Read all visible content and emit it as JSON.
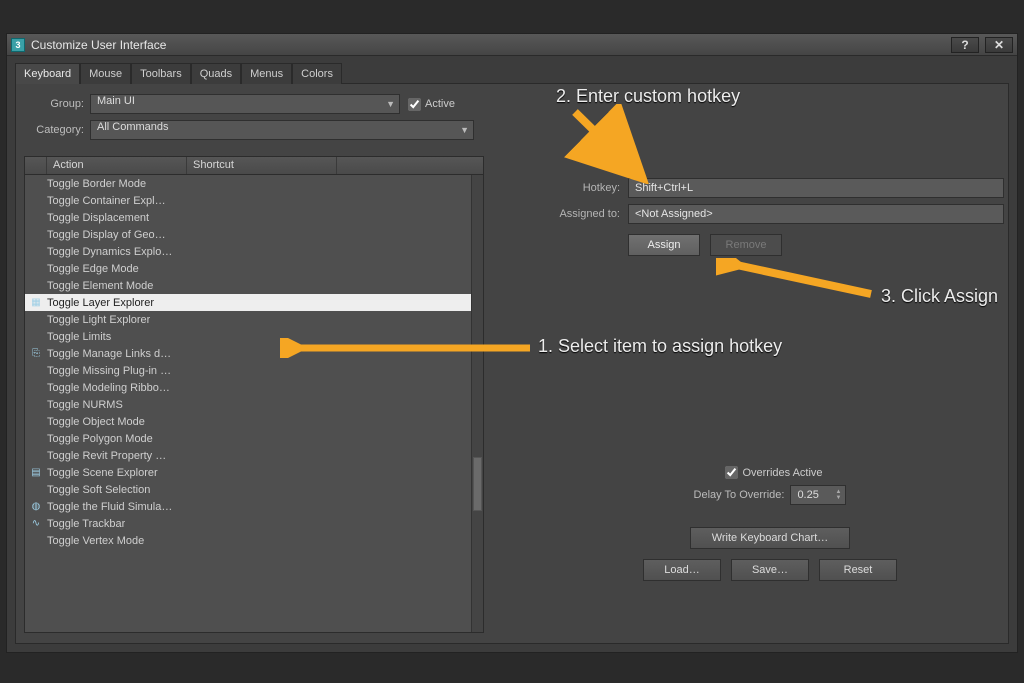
{
  "window": {
    "title": "Customize User Interface"
  },
  "tabs": [
    "Keyboard",
    "Mouse",
    "Toolbars",
    "Quads",
    "Menus",
    "Colors"
  ],
  "active_tab": 0,
  "group": {
    "label": "Group:",
    "value": "Main UI",
    "active_label": "Active"
  },
  "category": {
    "label": "Category:",
    "value": "All Commands"
  },
  "list": {
    "headers": {
      "action": "Action",
      "shortcut": "Shortcut"
    },
    "items": [
      {
        "icon": "",
        "label": "Toggle Border Mode"
      },
      {
        "icon": "",
        "label": "Toggle Container Expl…"
      },
      {
        "icon": "",
        "label": "Toggle Displacement"
      },
      {
        "icon": "",
        "label": "Toggle Display of Geo…"
      },
      {
        "icon": "",
        "label": "Toggle Dynamics Explo…"
      },
      {
        "icon": "",
        "label": "Toggle Edge Mode"
      },
      {
        "icon": "",
        "label": "Toggle Element Mode"
      },
      {
        "icon": "layer",
        "label": "Toggle Layer Explorer",
        "selected": true
      },
      {
        "icon": "",
        "label": "Toggle Light Explorer"
      },
      {
        "icon": "",
        "label": "Toggle Limits"
      },
      {
        "icon": "link",
        "label": "Toggle Manage Links d…"
      },
      {
        "icon": "",
        "label": "Toggle Missing Plug-in …"
      },
      {
        "icon": "",
        "label": "Toggle Modeling Ribbo…"
      },
      {
        "icon": "",
        "label": "Toggle NURMS"
      },
      {
        "icon": "",
        "label": "Toggle Object Mode"
      },
      {
        "icon": "",
        "label": "Toggle Polygon Mode"
      },
      {
        "icon": "",
        "label": "Toggle Revit Property …"
      },
      {
        "icon": "scene",
        "label": "Toggle Scene Explorer"
      },
      {
        "icon": "",
        "label": "Toggle Soft Selection"
      },
      {
        "icon": "fluid",
        "label": "Toggle the Fluid Simula…"
      },
      {
        "icon": "track",
        "label": "Toggle Trackbar"
      },
      {
        "icon": "",
        "label": "Toggle Vertex Mode"
      }
    ]
  },
  "hotkey": {
    "label": "Hotkey:",
    "value": "Shift+Ctrl+L"
  },
  "assigned": {
    "label": "Assigned to:",
    "value": "<Not Assigned>"
  },
  "buttons": {
    "assign": "Assign",
    "remove": "Remove",
    "write": "Write Keyboard Chart…",
    "load": "Load…",
    "save": "Save…",
    "reset": "Reset"
  },
  "overrides": {
    "active_label": "Overrides Active",
    "delay_label": "Delay To Override:",
    "delay_value": "0.25"
  },
  "annotations": {
    "a1": "1. Select item to assign hotkey",
    "a2": "2. Enter custom hotkey",
    "a3": "3. Click Assign"
  }
}
